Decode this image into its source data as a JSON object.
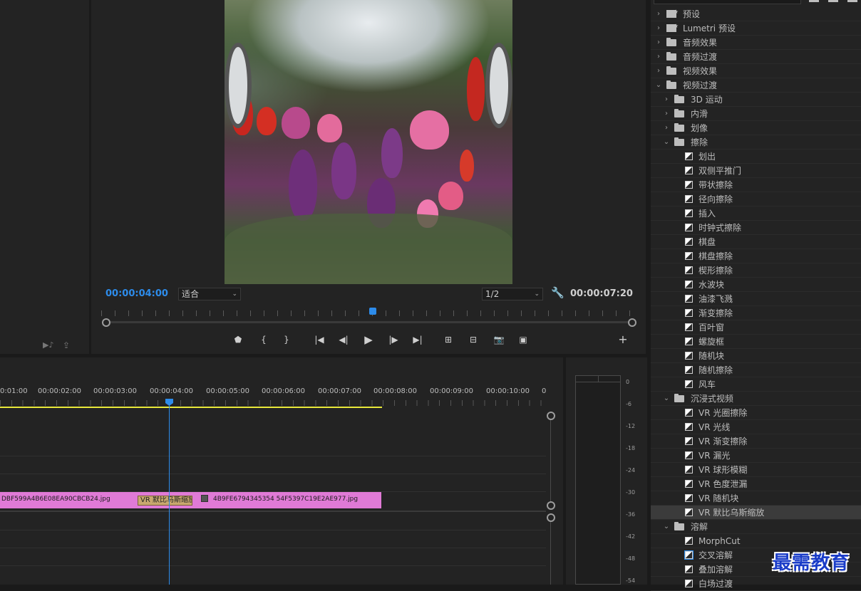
{
  "program_monitor": {
    "current_time": "00:00:04:00",
    "fit_label": "适合",
    "resolution_label": "1/2",
    "duration": "00:00:07:20"
  },
  "effects": {
    "rows": [
      {
        "label": "预设",
        "kind": "preset",
        "depth": 0,
        "expanded": false
      },
      {
        "label": "Lumetri 预设",
        "kind": "preset",
        "depth": 0,
        "expanded": false
      },
      {
        "label": "音频效果",
        "kind": "folder",
        "depth": 0,
        "expanded": false
      },
      {
        "label": "音频过渡",
        "kind": "folder",
        "depth": 0,
        "expanded": false
      },
      {
        "label": "视频效果",
        "kind": "folder",
        "depth": 0,
        "expanded": false
      },
      {
        "label": "视频过渡",
        "kind": "folder",
        "depth": 0,
        "expanded": true
      },
      {
        "label": "3D 运动",
        "kind": "folder",
        "depth": 1,
        "expanded": false
      },
      {
        "label": "内滑",
        "kind": "folder",
        "depth": 1,
        "expanded": false
      },
      {
        "label": "划像",
        "kind": "folder",
        "depth": 1,
        "expanded": false
      },
      {
        "label": "擦除",
        "kind": "folder",
        "depth": 1,
        "expanded": true
      },
      {
        "label": "划出",
        "kind": "effect",
        "depth": 2
      },
      {
        "label": "双侧平推门",
        "kind": "effect",
        "depth": 2
      },
      {
        "label": "带状擦除",
        "kind": "effect",
        "depth": 2
      },
      {
        "label": "径向擦除",
        "kind": "effect",
        "depth": 2
      },
      {
        "label": "插入",
        "kind": "effect",
        "depth": 2
      },
      {
        "label": "时钟式擦除",
        "kind": "effect",
        "depth": 2
      },
      {
        "label": "棋盘",
        "kind": "effect",
        "depth": 2
      },
      {
        "label": "棋盘擦除",
        "kind": "effect",
        "depth": 2
      },
      {
        "label": "楔形擦除",
        "kind": "effect",
        "depth": 2
      },
      {
        "label": "水波块",
        "kind": "effect",
        "depth": 2
      },
      {
        "label": "油漆飞溅",
        "kind": "effect",
        "depth": 2
      },
      {
        "label": "渐变擦除",
        "kind": "effect",
        "depth": 2
      },
      {
        "label": "百叶窗",
        "kind": "effect",
        "depth": 2
      },
      {
        "label": "螺旋框",
        "kind": "effect",
        "depth": 2
      },
      {
        "label": "随机块",
        "kind": "effect",
        "depth": 2
      },
      {
        "label": "随机擦除",
        "kind": "effect",
        "depth": 2
      },
      {
        "label": "风车",
        "kind": "effect",
        "depth": 2
      },
      {
        "label": "沉浸式视频",
        "kind": "folder",
        "depth": 1,
        "expanded": true
      },
      {
        "label": "VR 光圈擦除",
        "kind": "effect",
        "depth": 2
      },
      {
        "label": "VR 光线",
        "kind": "effect",
        "depth": 2
      },
      {
        "label": "VR 渐变擦除",
        "kind": "effect",
        "depth": 2
      },
      {
        "label": "VR 漏光",
        "kind": "effect",
        "depth": 2
      },
      {
        "label": "VR 球形模糊",
        "kind": "effect",
        "depth": 2
      },
      {
        "label": "VR 色度泄漏",
        "kind": "effect",
        "depth": 2
      },
      {
        "label": "VR 随机块",
        "kind": "effect",
        "depth": 2
      },
      {
        "label": "VR 默比乌斯缩放",
        "kind": "effect",
        "depth": 2,
        "selected": true
      },
      {
        "label": "溶解",
        "kind": "folder",
        "depth": 1,
        "expanded": true
      },
      {
        "label": "MorphCut",
        "kind": "effect",
        "depth": 2
      },
      {
        "label": "交叉溶解",
        "kind": "effect",
        "depth": 2
      },
      {
        "label": "叠加溶解",
        "kind": "effect",
        "depth": 2
      },
      {
        "label": "白场过渡",
        "kind": "effect",
        "depth": 2
      }
    ]
  },
  "timeline": {
    "ruler": [
      "0:01:00",
      "00:00:02:00",
      "00:00:03:00",
      "00:00:04:00",
      "00:00:05:00",
      "00:00:06:00",
      "00:00:07:00",
      "00:00:08:00",
      "00:00:09:00",
      "00:00:10:00",
      "0"
    ],
    "clip_a": "DBF599A4B6E08EA90CBCB24.jpg",
    "transition": "VR 默比乌斯缩放",
    "clip_b": "4B9FE6794345354 54F5397C19E2AE977.jpg",
    "clip_color": "#e07ad6"
  },
  "meter": {
    "labels": [
      "0",
      "-6",
      "-12",
      "-18",
      "-24",
      "-30",
      "-36",
      "-42",
      "-48",
      "-54"
    ]
  },
  "watermark": "最需教育",
  "colors": {
    "accent": "#2d8ceb",
    "clip": "#e07ad6",
    "work_area": "#e8e83a"
  }
}
